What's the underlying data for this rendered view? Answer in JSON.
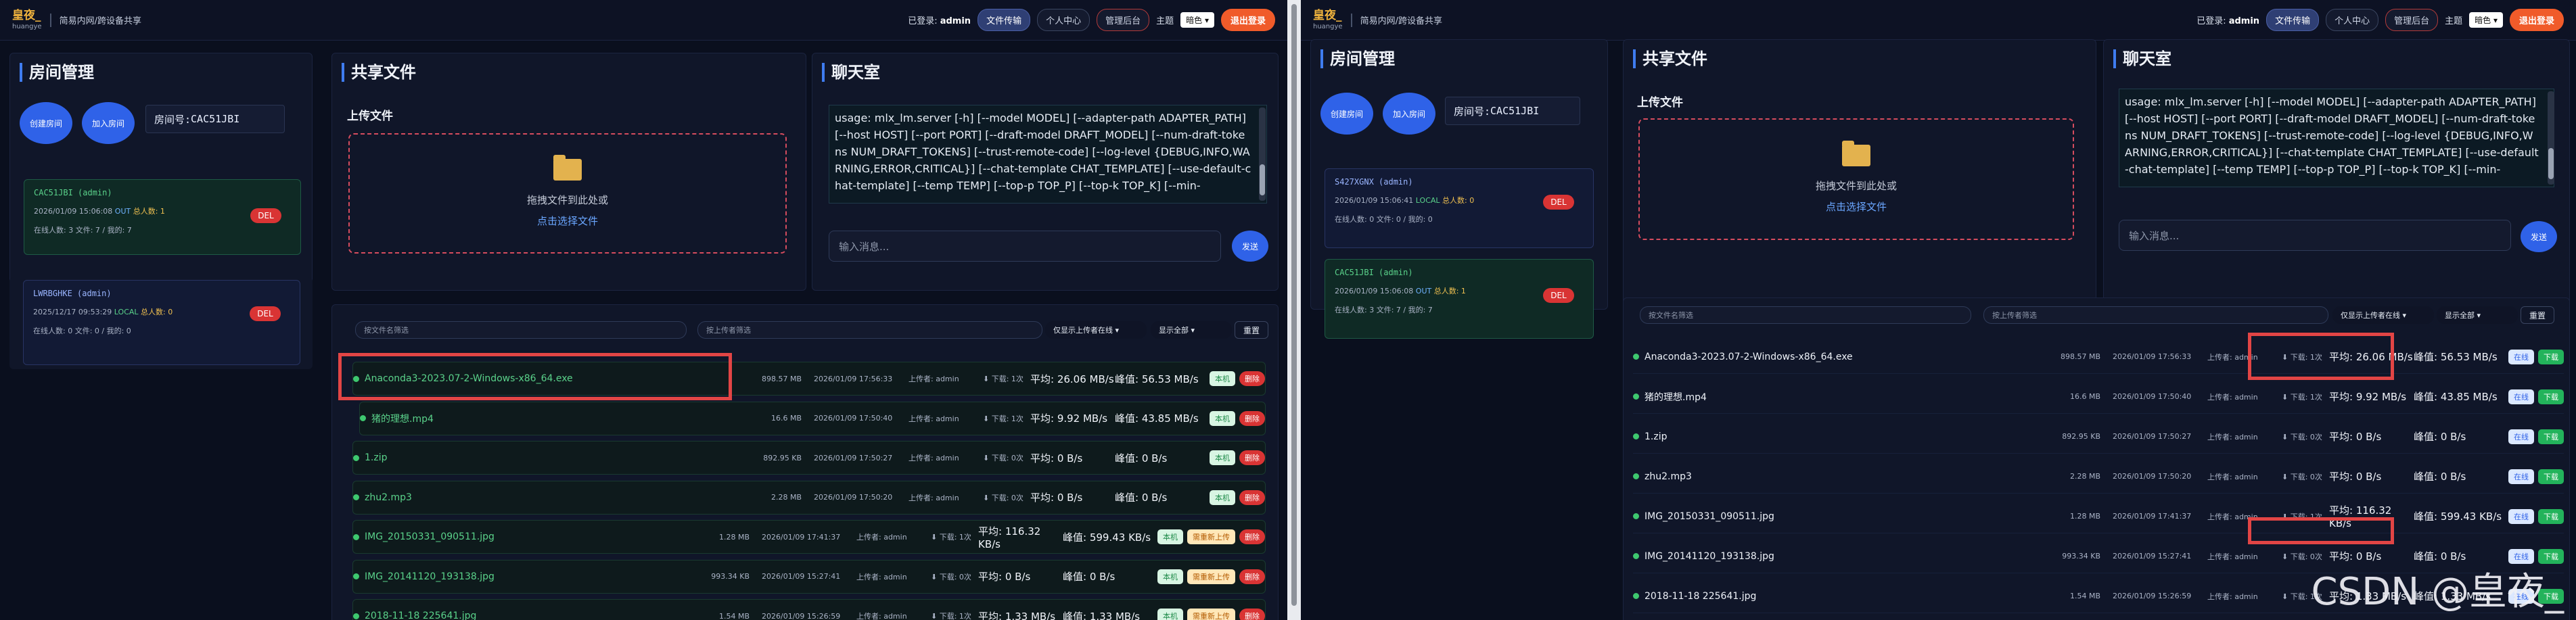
{
  "app": {
    "logo_main": "皇夜_",
    "logo_sub": "huangye",
    "subtitle": "简易内网/跨设备共享",
    "login_label": "已登录: ",
    "username": "admin",
    "nav": [
      "文件传输",
      "个人中心",
      "管理后台"
    ],
    "theme_label": "主题",
    "theme_value": "暗色",
    "logout": "退出登录"
  },
  "room": {
    "title": "房间管理",
    "create": "创建房间",
    "join": "加入房间",
    "room_id_label": "房间号: ",
    "room_id": "CAC51JBI",
    "del": "DEL",
    "online_label": "在线人数: ",
    "files_label": "文件: ",
    "total_label": "总人数: "
  },
  "left_rooms": [
    {
      "id": "CAC51JBI (admin)",
      "date": "2026/01/09 15:06:08",
      "mode": "OUT",
      "total": "1",
      "online": "3",
      "files": "7 / 我的: 7"
    },
    {
      "id": "LWRBGHKE (admin)",
      "date": "2025/12/17 09:53:29",
      "mode": "LOCAL",
      "total": "0",
      "online": "0",
      "files": "0 / 我的: 0"
    }
  ],
  "right_rooms": [
    {
      "id": "S427XGNX (admin)",
      "date": "2026/01/09 15:06:41",
      "mode": "LOCAL",
      "total": "0",
      "online": "0",
      "files": "0 / 我的: 0"
    },
    {
      "id": "CAC51JBI (admin)",
      "date": "2026/01/09 15:06:08",
      "mode": "OUT",
      "total": "1",
      "online": "3",
      "files": "7 / 我的: 7"
    }
  ],
  "share": {
    "title": "共享文件",
    "upload_title": "上传文件",
    "drop_text": "拖拽文件到此处或",
    "click_text": "点击选择文件",
    "name_filter": "按文件名筛选",
    "uploader_filter": "按上传者筛选",
    "online_only": "仅显示上传者在线",
    "show_all": "显示全部",
    "reset": "重置"
  },
  "chat": {
    "title": "聊天室",
    "log": "usage: mlx_lm.server [-h] [--model MODEL] [--adapter-path ADAPTER_PATH] [--host HOST] [--port PORT] [--draft-model DRAFT_MODEL] [--num-draft-tokens NUM_DRAFT_TOKENS] [--trust-remote-code] [--log-level {DEBUG,INFO,WARNING,ERROR,CRITICAL}] [--chat-template CHAT_TEMPLATE] [--use-default-chat-template] [--temp TEMP] [--top-p TOP_P] [--top-k TOP_K] [--min-",
    "placeholder": "输入消息...",
    "send": "发送"
  },
  "labels": {
    "uploader": "上传者: ",
    "downloads": "下载: ",
    "avg": "平均: ",
    "peak": "峰值: ",
    "local": "本机",
    "delete": "删除",
    "reupload": "需重新上传",
    "online": "在线",
    "download": "下载"
  },
  "files": [
    {
      "name": "Anaconda3-2023.07-2-Windows-x86_64.exe",
      "size": "898.57 MB",
      "date": "2026/01/09 17:56:33",
      "uploader": "admin",
      "dl": "1次",
      "avg": "26.06 MB/s",
      "peak": "56.53 MB/s",
      "reup": false
    },
    {
      "name": "猪的理想.mp4",
      "size": "16.6 MB",
      "date": "2026/01/09 17:50:40",
      "uploader": "admin",
      "dl": "1次",
      "avg": "9.92 MB/s",
      "peak": "43.85 MB/s",
      "reup": false
    },
    {
      "name": "1.zip",
      "size": "892.95 KB",
      "date": "2026/01/09 17:50:27",
      "uploader": "admin",
      "dl": "0次",
      "avg": "0 B/s",
      "peak": "0 B/s",
      "reup": false
    },
    {
      "name": "zhu2.mp3",
      "size": "2.28 MB",
      "date": "2026/01/09 17:50:20",
      "uploader": "admin",
      "dl": "0次",
      "avg": "0 B/s",
      "peak": "0 B/s",
      "reup": false
    },
    {
      "name": "IMG_20150331_090511.jpg",
      "size": "1.28 MB",
      "date": "2026/01/09 17:41:37",
      "uploader": "admin",
      "dl": "1次",
      "avg": "116.32 KB/s",
      "peak": "599.43 KB/s",
      "reup": true
    },
    {
      "name": "IMG_20141120_193138.jpg",
      "size": "993.34 KB",
      "date": "2026/01/09 15:27:41",
      "uploader": "admin",
      "dl": "0次",
      "avg": "0 B/s",
      "peak": "0 B/s",
      "reup": true
    },
    {
      "name": "2018-11-18 225641.jpg",
      "size": "1.54 MB",
      "date": "2026/01/09 15:26:59",
      "uploader": "admin",
      "dl": "1次",
      "avg": "1.33 MB/s",
      "peak": "1.33 MB/s",
      "reup": true
    }
  ],
  "watermark": "CSDN @皇夜_"
}
